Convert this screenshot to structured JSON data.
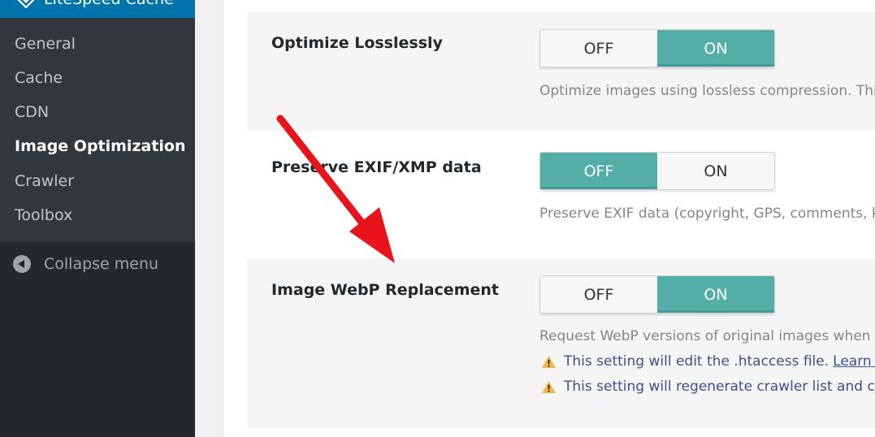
{
  "sidebar": {
    "top_item": {
      "label": "LiteSpeed Cache",
      "icon": "litespeed-diamond-icon"
    },
    "submenu": [
      {
        "label": "General",
        "current": false
      },
      {
        "label": "Cache",
        "current": false
      },
      {
        "label": "CDN",
        "current": false
      },
      {
        "label": "Image Optimization",
        "current": true
      },
      {
        "label": "Crawler",
        "current": false
      },
      {
        "label": "Toolbox",
        "current": false
      }
    ],
    "collapse": {
      "label": "Collapse menu",
      "icon": "collapse-arrow-icon"
    }
  },
  "settings": [
    {
      "label": "Optimize Losslessly",
      "off_label": "OFF",
      "on_label": "ON",
      "value": "ON",
      "description": "Optimize images using lossless compression. This ca"
    },
    {
      "label": "Preserve EXIF/XMP data",
      "off_label": "OFF",
      "on_label": "ON",
      "value": "OFF",
      "description": "Preserve EXIF data (copyright, GPS, comments, keyw"
    },
    {
      "label": "Image WebP Replacement",
      "off_label": "OFF",
      "on_label": "ON",
      "value": "ON",
      "description": "Request WebP versions of original images when doin",
      "warnings": [
        {
          "text": "This setting will edit the .htaccess file.",
          "link": "Learn Mor"
        },
        {
          "text": "This setting will regenerate crawler list and clear"
        }
      ]
    }
  ],
  "colors": {
    "sidebar_bg": "#23282d",
    "submenu_bg": "#32373c",
    "toggle_active": "#53aea8",
    "arrow": "#e8141b",
    "warning": "#f0b849"
  }
}
